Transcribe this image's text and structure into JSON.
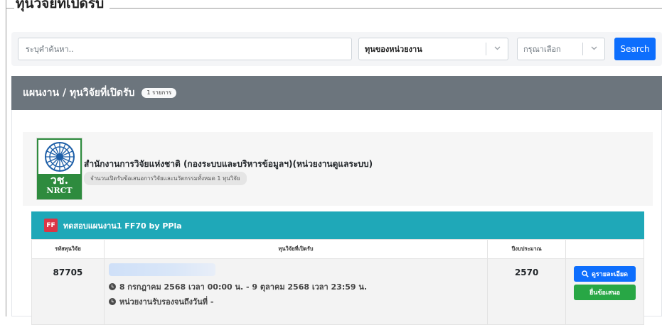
{
  "page": {
    "title": "ทุนวิจัยที่เปิดรับ"
  },
  "search": {
    "placeholder": "ระบุคำค้นหา..",
    "unit_select_value": "ทุนของหน่วยงาน",
    "choose_select_value": "กรุณาเลือก",
    "button_label": "Search"
  },
  "board": {
    "title": "แผนงาน / ทุนวิจัยที่เปิดรับ",
    "count_badge": "1 รายการ"
  },
  "organization": {
    "logo_thai": "วช.",
    "logo_eng": "NRCT",
    "name": "สำนักงานการวิจัยแห่งชาติ (กองระบบและบริหารข้อมูลฯ)(หน่วยงานดูแลระบบ)",
    "subtitle": "จำนวนเปิดรับข้อเสนอการวิจัยและนวัตกรรมทั้งหมด 1 ทุนวิจัย"
  },
  "plan": {
    "badge": "FF",
    "title": "ทดสอบแผนงาน1 FF70 by PPla"
  },
  "table": {
    "headers": [
      "รหัสทุนวิจัย",
      "ทุนวิจัยที่เปิดรับ",
      "ปีงบประมาณ",
      ""
    ],
    "rows": [
      {
        "code": "87705",
        "period": "8 กรกฎาคม 2568 เวลา 00:00 น. - 9 ตุลาคม 2568 เวลา 23:59 น.",
        "unit_note": "หน่วยงานรับรองจนถึงวันที่ -",
        "year": "2570",
        "detail_label": "ดูรายละเอียด",
        "submit_label": "ยื่นข้อเสนอ"
      }
    ]
  },
  "colors": {
    "primary": "#0d6efd",
    "success": "#28a745",
    "board_header": "#6c757d",
    "plan_header": "#1fa8b8",
    "ff_badge": "#dc3545",
    "logo_green": "#2e8b3e"
  }
}
